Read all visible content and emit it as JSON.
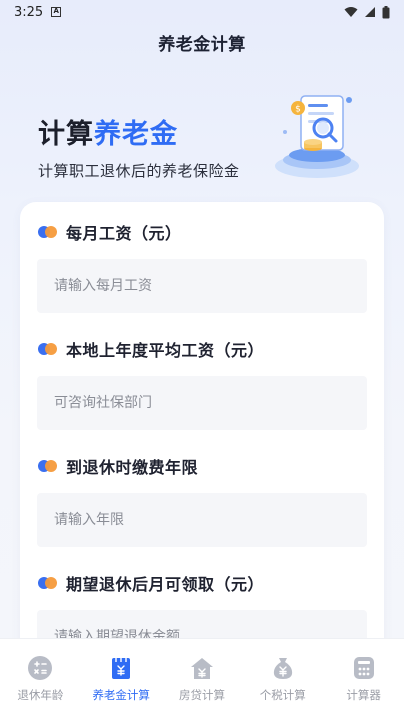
{
  "status_bar": {
    "time": "3:25",
    "notification_glyph": "A"
  },
  "nav": {
    "title": "养老金计算"
  },
  "hero": {
    "title_plain": "计算",
    "title_accent": "养老金",
    "subtitle": "计算职工退休后的养老保险金"
  },
  "form": {
    "fields": [
      {
        "label": "每月工资（元）",
        "placeholder": "请输入每月工资"
      },
      {
        "label": "本地上年度平均工资（元）",
        "placeholder": "可咨询社保部门"
      },
      {
        "label": "到退休时缴费年限",
        "placeholder": "请输入年限"
      },
      {
        "label": "期望退休后月可领取（元）",
        "placeholder": "请输入期望退休金额"
      }
    ]
  },
  "tabs": [
    {
      "label": "退休年龄",
      "icon": "calculator-icon",
      "active": false
    },
    {
      "label": "养老金计算",
      "icon": "document-icon",
      "active": true
    },
    {
      "label": "房贷计算",
      "icon": "house-yuan-icon",
      "active": false
    },
    {
      "label": "个税计算",
      "icon": "money-bag-icon",
      "active": false
    },
    {
      "label": "计算器",
      "icon": "keypad-icon",
      "active": false
    }
  ],
  "colors": {
    "accent": "#2f6cf4",
    "dot_blue": "#3a6ff0",
    "dot_orange": "#f59a3a"
  }
}
